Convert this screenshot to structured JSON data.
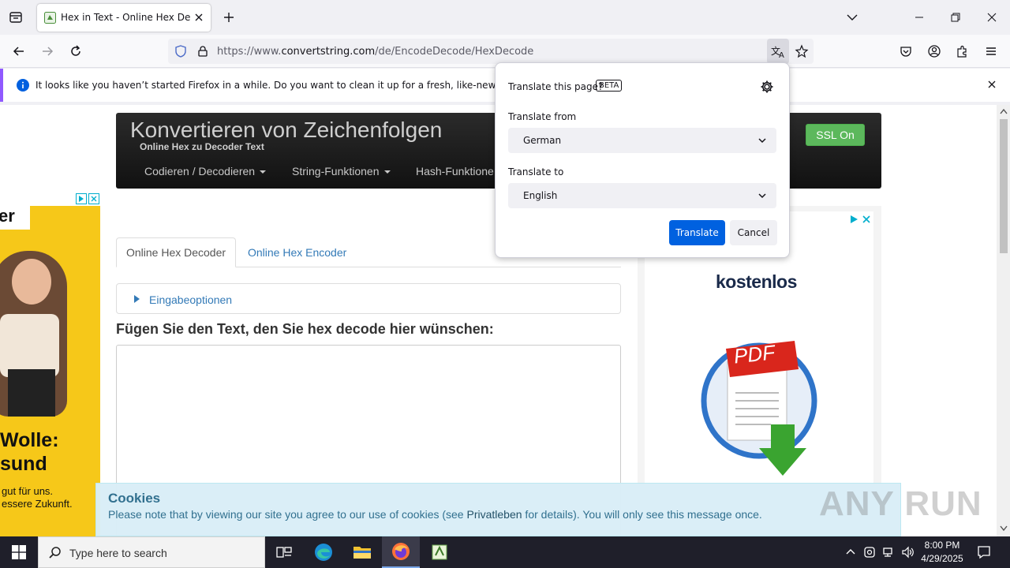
{
  "browser": {
    "tab": {
      "title": "Hex in Text - Online Hex Decod"
    },
    "url": {
      "prefix": "https://www.",
      "domain": "convertstring.com",
      "path": "/de/EncodeDecode/HexDecode"
    },
    "notification": "It looks like you haven’t started Firefox in a while. Do you want to clean it up for a fresh, like-new experience? A"
  },
  "site": {
    "title": "Konvertieren von Zeichenfolgen",
    "subtitle": "Online Hex zu Decoder Text",
    "menu": [
      {
        "label": "Codieren / Decodieren"
      },
      {
        "label": "String-Funktionen"
      },
      {
        "label": "Hash-Funktione"
      }
    ],
    "ssl_button": "SSL On",
    "tabs": {
      "active": "Online Hex Decoder",
      "other": "Online Hex Encoder"
    },
    "options_label": "Eingabeoptionen",
    "section_heading": "Fügen Sie den Text, den Sie hex decode hier wünschen:",
    "left_ad": {
      "text_brand": "er",
      "line1": "Wolle:",
      "line2": "sund",
      "line3": "gut für uns.",
      "line4": "essere Zukunft."
    },
    "right_ad": {
      "text": "kostenlos",
      "badge": "PDF"
    },
    "cookie": {
      "heading": "Cookies",
      "text_before": "Please note that by viewing our site you agree to our use of cookies (see ",
      "link": "Privatleben",
      "text_after": " for details). You will only see this message once."
    }
  },
  "translate_popup": {
    "title": "Translate this page?",
    "badge": "BETA",
    "from_label": "Translate from",
    "from_value": "German",
    "to_label": "Translate to",
    "to_value": "English",
    "translate_button": "Translate",
    "cancel_button": "Cancel"
  },
  "taskbar": {
    "search_placeholder": "Type here to search",
    "time": "8:00 PM",
    "date": "4/29/2025"
  },
  "watermark": "ANY RUN"
}
